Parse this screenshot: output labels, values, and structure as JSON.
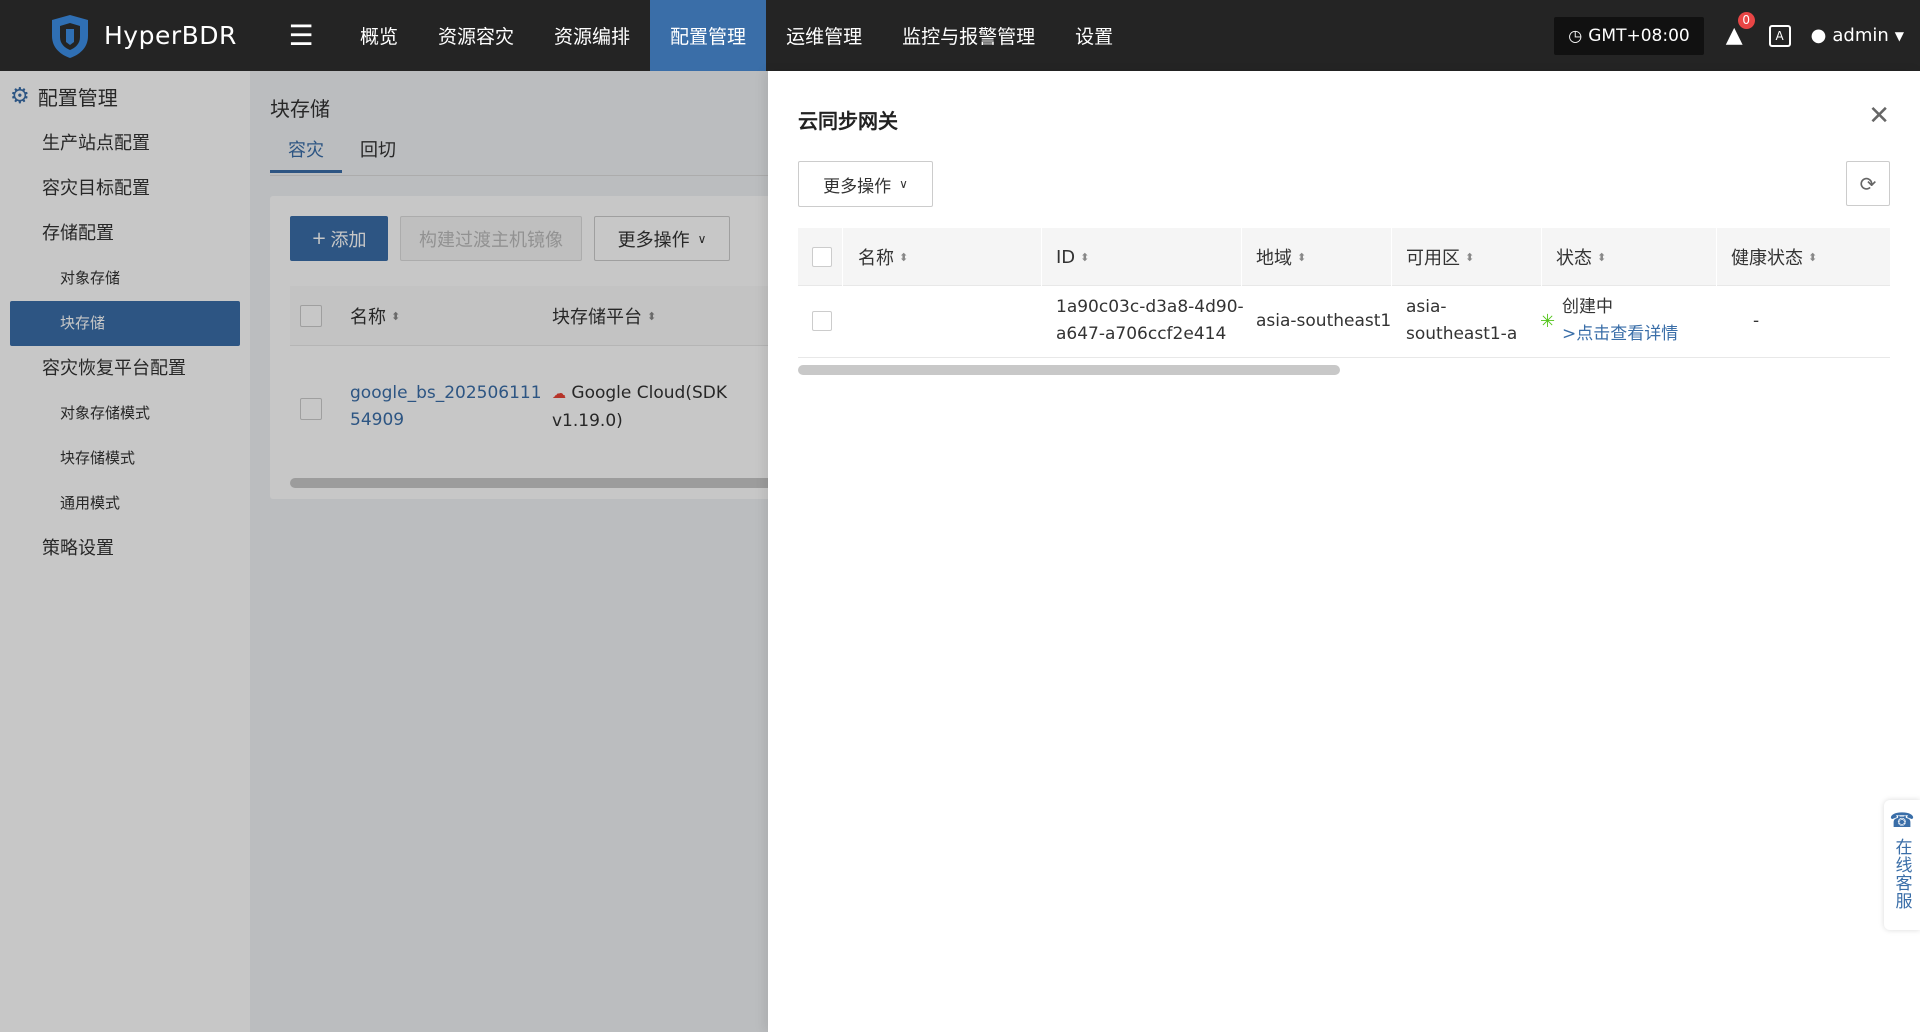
{
  "topbar": {
    "brand": "HyperBDR",
    "nav": [
      "概览",
      "资源容灾",
      "资源编排",
      "配置管理",
      "运维管理",
      "监控与报警管理",
      "设置"
    ],
    "active_nav": "配置管理",
    "timezone": "GMT+08:00",
    "alert_count": "0",
    "translate_icon": "A",
    "user": "admin"
  },
  "sidebar": {
    "title": "配置管理",
    "items": [
      {
        "label": "生产站点配置",
        "level": 1
      },
      {
        "label": "容灾目标配置",
        "level": 1
      },
      {
        "label": "存储配置",
        "level": 1
      },
      {
        "label": "对象存储",
        "level": 2
      },
      {
        "label": "块存储",
        "level": 2,
        "active": true
      },
      {
        "label": "容灾恢复平台配置",
        "level": 1
      },
      {
        "label": "对象存储模式",
        "level": 2
      },
      {
        "label": "块存储模式",
        "level": 2
      },
      {
        "label": "通用模式",
        "level": 2
      },
      {
        "label": "策略设置",
        "level": 1
      }
    ]
  },
  "main": {
    "title": "块存储",
    "tabs": [
      "容灾",
      "回切"
    ],
    "active_tab": "容灾",
    "buttons": {
      "add": "添加",
      "build": "构建过渡主机镜像",
      "more": "更多操作"
    },
    "columns": [
      "名称",
      "块存储平台"
    ],
    "rows": [
      {
        "name_line1": "google_bs_202506111",
        "name_line2": "54909",
        "platform_line1": "Google Cloud(SDK",
        "platform_line2": "v1.19.0)"
      }
    ]
  },
  "drawer": {
    "title": "云同步网关",
    "more_button": "更多操作",
    "columns": [
      "名称",
      "ID",
      "地域",
      "可用区",
      "状态",
      "健康状态"
    ],
    "rows": [
      {
        "name": "",
        "id_line1": "1a90c03c-d3a8-4d90-",
        "id_line2": "a647-a706ccf2e414",
        "region": "asia-southeast1",
        "zone_line1": "asia-",
        "zone_line2": "southeast1-a",
        "status": "创建中",
        "status_link": ">点击查看详情",
        "health": "-"
      }
    ]
  },
  "service": {
    "label": "在线客服"
  },
  "colors": {
    "topbar": "#242424",
    "accent": "#3a6ea8",
    "status_ok": "#52c41a"
  }
}
